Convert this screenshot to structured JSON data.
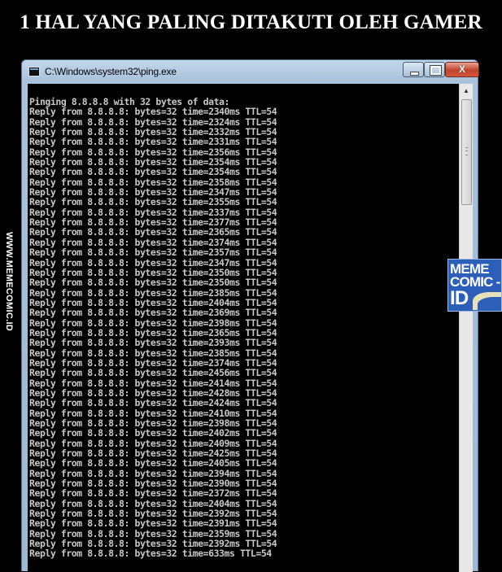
{
  "headline": "1 HAL YANG PALING DITAKUTI OLEH GAMER",
  "watermark_side": "WWW.MEMECOMIC.ID",
  "badge": {
    "line1": "MEME",
    "line2": "COMIC -",
    "line3": "ID"
  },
  "window": {
    "title": "C:\\Windows\\system32\\ping.exe",
    "close_label": "X",
    "icon": "console-app-icon"
  },
  "console": {
    "header": "Pinging 8.8.8.8 with 32 bytes of data:",
    "lines": [
      "Reply from 8.8.8.8: bytes=32 time=2340ms TTL=54",
      "Reply from 8.8.8.8: bytes=32 time=2324ms TTL=54",
      "Reply from 8.8.8.8: bytes=32 time=2332ms TTL=54",
      "Reply from 8.8.8.8: bytes=32 time=2331ms TTL=54",
      "Reply from 8.8.8.8: bytes=32 time=2356ms TTL=54",
      "Reply from 8.8.8.8: bytes=32 time=2354ms TTL=54",
      "Reply from 8.8.8.8: bytes=32 time=2354ms TTL=54",
      "Reply from 8.8.8.8: bytes=32 time=2358ms TTL=54",
      "Reply from 8.8.8.8: bytes=32 time=2347ms TTL=54",
      "Reply from 8.8.8.8: bytes=32 time=2355ms TTL=54",
      "Reply from 8.8.8.8: bytes=32 time=2337ms TTL=54",
      "Reply from 8.8.8.8: bytes=32 time=2377ms TTL=54",
      "Reply from 8.8.8.8: bytes=32 time=2365ms TTL=54",
      "Reply from 8.8.8.8: bytes=32 time=2374ms TTL=54",
      "Reply from 8.8.8.8: bytes=32 time=2357ms TTL=54",
      "Reply from 8.8.8.8: bytes=32 time=2347ms TTL=54",
      "Reply from 8.8.8.8: bytes=32 time=2350ms TTL=54",
      "Reply from 8.8.8.8: bytes=32 time=2350ms TTL=54",
      "Reply from 8.8.8.8: bytes=32 time=2385ms TTL=54",
      "Reply from 8.8.8.8: bytes=32 time=2404ms TTL=54",
      "Reply from 8.8.8.8: bytes=32 time=2369ms TTL=54",
      "Reply from 8.8.8.8: bytes=32 time=2398ms TTL=54",
      "Reply from 8.8.8.8: bytes=32 time=2365ms TTL=54",
      "Reply from 8.8.8.8: bytes=32 time=2393ms TTL=54",
      "Reply from 8.8.8.8: bytes=32 time=2385ms TTL=54",
      "Reply from 8.8.8.8: bytes=32 time=2374ms TTL=54",
      "Reply from 8.8.8.8: bytes=32 time=2456ms TTL=54",
      "Reply from 8.8.8.8: bytes=32 time=2414ms TTL=54",
      "Reply from 8.8.8.8: bytes=32 time=2428ms TTL=54",
      "Reply from 8.8.8.8: bytes=32 time=2424ms TTL=54",
      "Reply from 8.8.8.8: bytes=32 time=2410ms TTL=54",
      "Reply from 8.8.8.8: bytes=32 time=2398ms TTL=54",
      "Reply from 8.8.8.8: bytes=32 time=2402ms TTL=54",
      "Reply from 8.8.8.8: bytes=32 time=2409ms TTL=54",
      "Reply from 8.8.8.8: bytes=32 time=2425ms TTL=54",
      "Reply from 8.8.8.8: bytes=32 time=2405ms TTL=54",
      "Reply from 8.8.8.8: bytes=32 time=2394ms TTL=54",
      "Reply from 8.8.8.8: bytes=32 time=2390ms TTL=54",
      "Reply from 8.8.8.8: bytes=32 time=2372ms TTL=54",
      "Reply from 8.8.8.8: bytes=32 time=2404ms TTL=54",
      "Reply from 8.8.8.8: bytes=32 time=2392ms TTL=54",
      "Reply from 8.8.8.8: bytes=32 time=2391ms TTL=54",
      "Reply from 8.8.8.8: bytes=32 time=2359ms TTL=54",
      "Reply from 8.8.8.8: bytes=32 time=2392ms TTL=54",
      "Reply from 8.8.8.8: bytes=32 time=633ms TTL=54"
    ]
  },
  "colors": {
    "background": "#000000",
    "console_text": "#c8c8c8",
    "title_bar": "#a8c2dc",
    "close_button": "#c0442a",
    "badge": "#2c5fb8"
  }
}
